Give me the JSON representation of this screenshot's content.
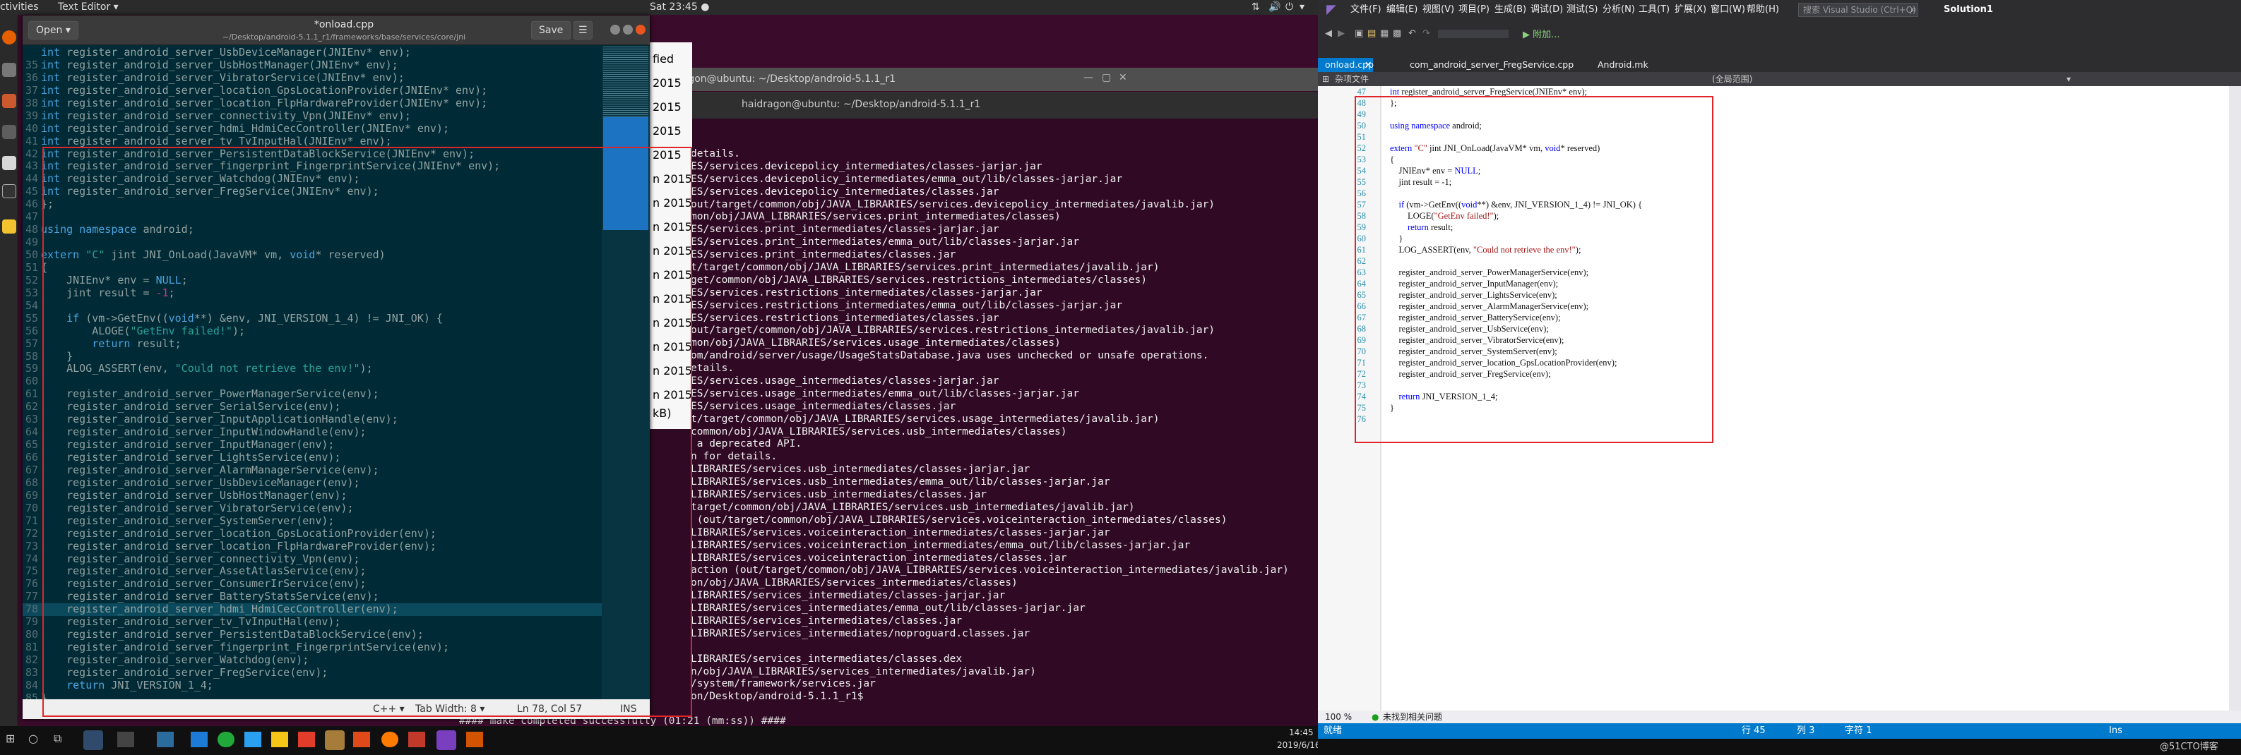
{
  "topbar": {
    "activities": "ctivities",
    "app": "Text Editor ▾",
    "clock": "Sat 23:45 ●"
  },
  "gedit": {
    "open_label": "Open ▾",
    "file_title": "*onload.cpp",
    "file_path": "~/Desktop/android-5.1.1_r1/frameworks/base/services/core/jni",
    "save_label": "Save",
    "menu_label": "☰",
    "code": [
      {
        "n": "",
        "t": "int register_android_server_UsbDeviceManager(JNIEnv* env);"
      },
      {
        "n": "35",
        "t": "int register_android_server_UsbHostManager(JNIEnv* env);"
      },
      {
        "n": "36",
        "t": "int register_android_server_VibratorService(JNIEnv* env);"
      },
      {
        "n": "37",
        "t": "int register_android_server_location_GpsLocationProvider(JNIEnv* env);"
      },
      {
        "n": "38",
        "t": "int register_android_server_location_FlpHardwareProvider(JNIEnv* env);"
      },
      {
        "n": "39",
        "t": "int register_android_server_connectivity_Vpn(JNIEnv* env);"
      },
      {
        "n": "40",
        "t": "int register_android_server_hdmi_HdmiCecController(JNIEnv* env);"
      },
      {
        "n": "41",
        "t": "int register_android_server_tv_TvInputHal(JNIEnv* env);"
      },
      {
        "n": "42",
        "t": "int register_android_server_PersistentDataBlockService(JNIEnv* env);"
      },
      {
        "n": "43",
        "t": "int register_android_server_fingerprint_FingerprintService(JNIEnv* env);"
      },
      {
        "n": "44",
        "t": "int register_android_server_Watchdog(JNIEnv* env);"
      },
      {
        "n": "45",
        "t": "int register_android_server_FregService(JNIEnv* env);"
      },
      {
        "n": "46",
        "t": "};"
      },
      {
        "n": "47",
        "t": ""
      },
      {
        "n": "48",
        "t": "using namespace android;"
      },
      {
        "n": "49",
        "t": ""
      },
      {
        "n": "50",
        "t": "extern \"C\" jint JNI_OnLoad(JavaVM* vm, void* reserved)"
      },
      {
        "n": "51",
        "t": "{"
      },
      {
        "n": "52",
        "t": "    JNIEnv* env = NULL;"
      },
      {
        "n": "53",
        "t": "    jint result = -1;"
      },
      {
        "n": "54",
        "t": ""
      },
      {
        "n": "55",
        "t": "    if (vm->GetEnv((void**) &env, JNI_VERSION_1_4) != JNI_OK) {"
      },
      {
        "n": "56",
        "t": "        ALOGE(\"GetEnv failed!\");"
      },
      {
        "n": "57",
        "t": "        return result;"
      },
      {
        "n": "58",
        "t": "    }"
      },
      {
        "n": "59",
        "t": "    ALOG_ASSERT(env, \"Could not retrieve the env!\");"
      },
      {
        "n": "60",
        "t": ""
      },
      {
        "n": "61",
        "t": "    register_android_server_PowerManagerService(env);"
      },
      {
        "n": "62",
        "t": "    register_android_server_SerialService(env);"
      },
      {
        "n": "63",
        "t": "    register_android_server_InputApplicationHandle(env);"
      },
      {
        "n": "64",
        "t": "    register_android_server_InputWindowHandle(env);"
      },
      {
        "n": "65",
        "t": "    register_android_server_InputManager(env);"
      },
      {
        "n": "66",
        "t": "    register_android_server_LightsService(env);"
      },
      {
        "n": "67",
        "t": "    register_android_server_AlarmManagerService(env);"
      },
      {
        "n": "68",
        "t": "    register_android_server_UsbDeviceManager(env);"
      },
      {
        "n": "69",
        "t": "    register_android_server_UsbHostManager(env);"
      },
      {
        "n": "70",
        "t": "    register_android_server_VibratorService(env);"
      },
      {
        "n": "71",
        "t": "    register_android_server_SystemServer(env);"
      },
      {
        "n": "72",
        "t": "    register_android_server_location_GpsLocationProvider(env);"
      },
      {
        "n": "73",
        "t": "    register_android_server_location_FlpHardwareProvider(env);"
      },
      {
        "n": "74",
        "t": "    register_android_server_connectivity_Vpn(env);"
      },
      {
        "n": "75",
        "t": "    register_android_server_AssetAtlasService(env);"
      },
      {
        "n": "76",
        "t": "    register_android_server_ConsumerIrService(env);"
      },
      {
        "n": "77",
        "t": "    register_android_server_BatteryStatsService(env);"
      },
      {
        "n": "78",
        "t": "    register_android_server_hdmi_HdmiCecController(env);"
      },
      {
        "n": "79",
        "t": "    register_android_server_tv_TvInputHal(env);"
      },
      {
        "n": "80",
        "t": "    register_android_server_PersistentDataBlockService(env);"
      },
      {
        "n": "81",
        "t": "    register_android_server_fingerprint_FingerprintService(env);"
      },
      {
        "n": "82",
        "t": "    register_android_server_Watchdog(env);"
      },
      {
        "n": "83",
        "t": "    register_android_server_FregService(env);"
      },
      {
        "n": "84",
        "t": "    return JNI_VERSION_1_4;"
      },
      {
        "n": "85",
        "t": "}"
      }
    ],
    "status": {
      "language": "C++ ▾",
      "tab_width": "Tab Width: 8 ▾",
      "position": "Ln 78, Col 57",
      "mode": "INS"
    }
  },
  "filelist": {
    "header": "fied",
    "items": [
      "2015",
      "2015",
      "2015",
      "2015",
      "n 2015",
      "n 2015",
      "n 2015",
      "n 2015",
      "n 2015",
      "n 2015",
      "n 2015",
      "n 2015",
      "n 2015",
      "n 2015"
    ],
    "size": "kB)"
  },
  "terminal": {
    "title_back": "ragon@ubuntu: ~/Desktop/android-5.1.1_r1",
    "title_front": "haidragon@ubuntu: ~/Desktop/android-5.1.1_r1",
    "lines": [
      "details.",
      "ES/services.devicepolicy_intermediates/classes-jarjar.jar",
      "ES/services.devicepolicy_intermediates/emma_out/lib/classes-jarjar.jar",
      "ES/services.devicepolicy_intermediates/classes.jar",
      "out/target/common/obj/JAVA_LIBRARIES/services.devicepolicy_intermediates/javalib.jar)",
      "mon/obj/JAVA_LIBRARIES/services.print_intermediates/classes)",
      "ES/services.print_intermediates/classes-jarjar.jar",
      "ES/services.print_intermediates/emma_out/lib/classes-jarjar.jar",
      "ES/services.print_intermediates/classes.jar",
      "t/target/common/obj/JAVA_LIBRARIES/services.print_intermediates/javalib.jar)",
      "get/common/obj/JAVA_LIBRARIES/services.restrictions_intermediates/classes)",
      "ES/services.restrictions_intermediates/classes-jarjar.jar",
      "ES/services.restrictions_intermediates/emma_out/lib/classes-jarjar.jar",
      "ES/services.restrictions_intermediates/classes.jar",
      "out/target/common/obj/JAVA_LIBRARIES/services.restrictions_intermediates/javalib.jar)",
      "mon/obj/JAVA_LIBRARIES/services.usage_intermediates/classes)",
      "om/android/server/usage/UsageStatsDatabase.java uses unchecked or unsafe operations.",
      "etails.",
      "ES/services.usage_intermediates/classes-jarjar.jar",
      "ES/services.usage_intermediates/emma_out/lib/classes-jarjar.jar",
      "ES/services.usage_intermediates/classes.jar",
      "t/target/common/obj/JAVA_LIBRARIES/services.usage_intermediates/javalib.jar)",
      "common/obj/JAVA_LIBRARIES/services.usb_intermediates/classes)",
      " a deprecated API.",
      "n for details.",
      "LIBRARIES/services.usb_intermediates/classes-jarjar.jar",
      "LIBRARIES/services.usb_intermediates/emma_out/lib/classes-jarjar.jar",
      "LIBRARIES/services.usb_intermediates/classes.jar",
      "target/common/obj/JAVA_LIBRARIES/services.usb_intermediates/javalib.jar)",
      " (out/target/common/obj/JAVA_LIBRARIES/services.voiceinteraction_intermediates/classes)",
      "LIBRARIES/services.voiceinteraction_intermediates/classes-jarjar.jar",
      "LIBRARIES/services.voiceinteraction_intermediates/emma_out/lib/classes-jarjar.jar",
      "LIBRARIES/services.voiceinteraction_intermediates/classes.jar",
      "action (out/target/common/obj/JAVA_LIBRARIES/services.voiceinteraction_intermediates/javalib.jar)",
      "on/obj/JAVA_LIBRARIES/services_intermediates/classes)",
      "LIBRARIES/services_intermediates/classes-jarjar.jar",
      "LIBRARIES/services_intermediates/emma_out/lib/classes-jarjar.jar",
      "LIBRARIES/services_intermediates/classes.jar",
      "LIBRARIES/services_intermediates/noproguard.classes.jar",
      "",
      "LIBRARIES/services_intermediates/classes.dex",
      "n/obj/JAVA_LIBRARIES/services_intermediates/javalib.jar)",
      "/system/framework/services.jar",
      "on/Desktop/android-5.1.1_r1$"
    ],
    "bottom_line": "#### make completed successfully (01:21 (mm:ss)) ####"
  },
  "taskbar": {
    "time": "14:45",
    "date": "2019/6/16"
  },
  "vs": {
    "menu": [
      "文件(F)",
      "编辑(E)",
      "视图(V)",
      "项目(P)",
      "生成(B)",
      "调试(D)",
      "测试(S)",
      "分析(N)",
      "工具(T)",
      "扩展(X)",
      "窗口(W)",
      "帮助(H)"
    ],
    "search_placeholder": "搜索 Visual Studio (Ctrl+Q)",
    "solution": "Solution1",
    "attach_label": "▶ 附加...",
    "tabs": [
      "onload.cpp",
      "com_android_server_FregService.cpp",
      "Android.mk"
    ],
    "nav_left": "杂项文件",
    "nav_mid": "(全局范围)",
    "code": [
      {
        "n": "47",
        "t": "int register_android_server_FregService(JNIEnv* env);"
      },
      {
        "n": "48",
        "t": "};"
      },
      {
        "n": "49",
        "t": ""
      },
      {
        "n": "50",
        "t": "using namespace android;"
      },
      {
        "n": "51",
        "t": ""
      },
      {
        "n": "52",
        "t": "extern \"C\" jint JNI_OnLoad(JavaVM* vm, void* reserved)"
      },
      {
        "n": "53",
        "t": "{"
      },
      {
        "n": "54",
        "t": "    JNIEnv* env = NULL;"
      },
      {
        "n": "55",
        "t": "    jint result = -1;"
      },
      {
        "n": "56",
        "t": ""
      },
      {
        "n": "57",
        "t": "    if (vm->GetEnv((void**) &env, JNI_VERSION_1_4) != JNI_OK) {"
      },
      {
        "n": "58",
        "t": "        LOGE(\"GetEnv failed!\");"
      },
      {
        "n": "59",
        "t": "        return result;"
      },
      {
        "n": "60",
        "t": "    }"
      },
      {
        "n": "61",
        "t": "    LOG_ASSERT(env, \"Could not retrieve the env!\");"
      },
      {
        "n": "62",
        "t": ""
      },
      {
        "n": "63",
        "t": "    register_android_server_PowerManagerService(env);"
      },
      {
        "n": "64",
        "t": "    register_android_server_InputManager(env);"
      },
      {
        "n": "65",
        "t": "    register_android_server_LightsService(env);"
      },
      {
        "n": "66",
        "t": "    register_android_server_AlarmManagerService(env);"
      },
      {
        "n": "67",
        "t": "    register_android_server_BatteryService(env);"
      },
      {
        "n": "68",
        "t": "    register_android_server_UsbService(env);"
      },
      {
        "n": "69",
        "t": "    register_android_server_VibratorService(env);"
      },
      {
        "n": "70",
        "t": "    register_android_server_SystemServer(env);"
      },
      {
        "n": "71",
        "t": "    register_android_server_location_GpsLocationProvider(env);"
      },
      {
        "n": "72",
        "t": "    register_android_server_FregService(env);"
      },
      {
        "n": "73",
        "t": ""
      },
      {
        "n": "74",
        "t": "    return JNI_VERSION_1_4;"
      },
      {
        "n": "75",
        "t": "}"
      },
      {
        "n": "76",
        "t": ""
      }
    ],
    "zoom": "100 %",
    "issues": "未找到相关问题",
    "status_ready": "就绪",
    "status_line": "行 45",
    "status_col": "列 3",
    "status_char": "字符 1",
    "status_ins": "Ins",
    "watermark": "@51CTO博客"
  }
}
